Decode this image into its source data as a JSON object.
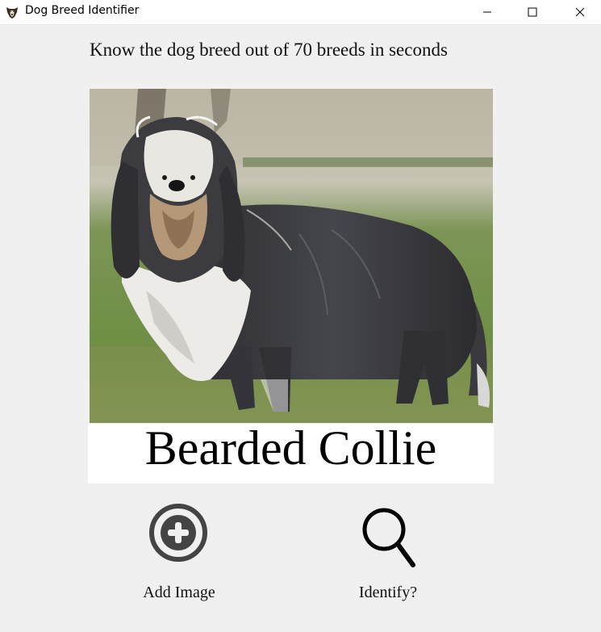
{
  "window": {
    "title": "Dog Breed Identifier",
    "icon": "dog-head-icon",
    "controls": [
      "minimize-icon",
      "maximize-icon",
      "close-icon"
    ]
  },
  "header": {
    "tagline": "Know the dog breed out of 70 breeds in seconds"
  },
  "image": {
    "subject": "dog-photo"
  },
  "result": {
    "breed": "Bearded Collie"
  },
  "actions": {
    "add_image": {
      "label": "Add Image",
      "icon": "add-circle-icon"
    },
    "identify": {
      "label": "Identify?",
      "icon": "search-icon"
    }
  },
  "colors": {
    "window_bg": "#f0f0f0",
    "titlebar_bg": "#ffffff",
    "result_bg": "#ffffff",
    "add_icon": "#444444",
    "search_icon": "#000000"
  }
}
